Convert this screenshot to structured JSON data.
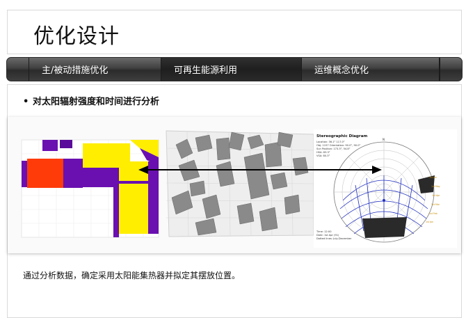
{
  "page": {
    "title": "优化设计"
  },
  "tabs": [
    {
      "label": "主/被动措施优化"
    },
    {
      "label": "可再生能源利用"
    },
    {
      "label": "运维概念优化"
    }
  ],
  "content": {
    "bullet": "•",
    "heading": "对太阳辐射强度和时间进行分析",
    "caption": "通过分析数据，确定采用太阳能集热器并拟定其摆放位置。"
  },
  "stereographic": {
    "title": "Stereographic Diagram",
    "info_lines": [
      "Location: 36.1° 117.0°",
      "Obj: 1157 Orientation: 90.0°, 90.0°",
      "Sun Position: 173.3°, 54.8°",
      "HSA: 83.3°",
      "VSA: 80.3°"
    ],
    "footer_lines": [
      "Time: 12:00",
      "Date: 1st Apr (91)",
      "Dotted lines: July-December"
    ],
    "month_labels": [
      "1st Jun",
      "1st May",
      "1st Apr",
      "1st Mar",
      "1st Feb",
      "1st Jan"
    ],
    "north_label": "N"
  },
  "colors": {
    "tab_dark": "#3a3a3a",
    "building_yellow": "#ffee00",
    "building_purple": "#6a10b0",
    "building_red": "#ff3b0a",
    "sun_path_blue": "#2230c0"
  }
}
